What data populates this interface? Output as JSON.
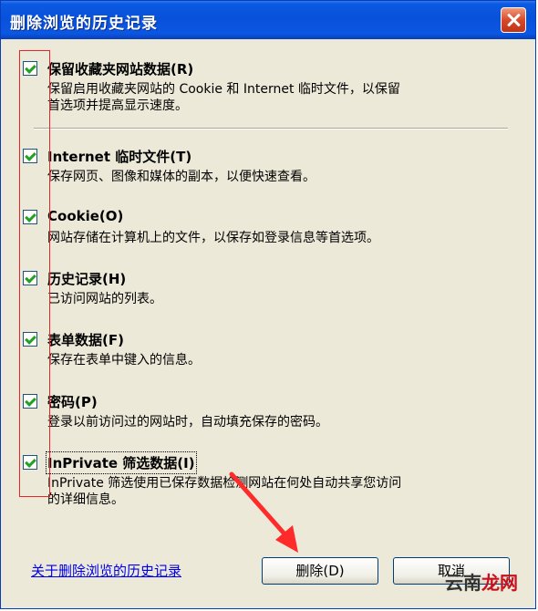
{
  "window": {
    "title": "删除浏览的历史记录"
  },
  "items": [
    {
      "title": "保留收藏夹网站数据(R)",
      "desc": [
        "保留启用收藏夹网站的 Cookie 和 Internet 临时文件，以保留",
        "首选项并提高显示速度。"
      ],
      "checked": true
    },
    {
      "title": "Internet 临时文件(T)",
      "desc": [
        "保存网页、图像和媒体的副本，以便快速查看。"
      ],
      "checked": true
    },
    {
      "title": "Cookie(O)",
      "desc": [
        "网站存储在计算机上的文件，以保存如登录信息等首选项。"
      ],
      "checked": true
    },
    {
      "title": "历史记录(H)",
      "desc": [
        "已访问网站的列表。"
      ],
      "checked": true
    },
    {
      "title": "表单数据(F)",
      "desc": [
        "保存在表单中键入的信息。"
      ],
      "checked": true
    },
    {
      "title": "密码(P)",
      "desc": [
        "登录以前访问过的网站时，自动填充保存的密码。"
      ],
      "checked": true
    },
    {
      "title": "InPrivate 筛选数据(I)",
      "desc": [
        "InPrivate 筛选使用已保存数据检测网站在何处自动共享您访问",
        "的详细信息。"
      ],
      "checked": true
    }
  ],
  "footer": {
    "link": "关于删除浏览的历史记录",
    "delete_button": "删除(D)",
    "cancel_button": "取消"
  },
  "watermark": {
    "part1": "云南",
    "part2": "龙网"
  }
}
